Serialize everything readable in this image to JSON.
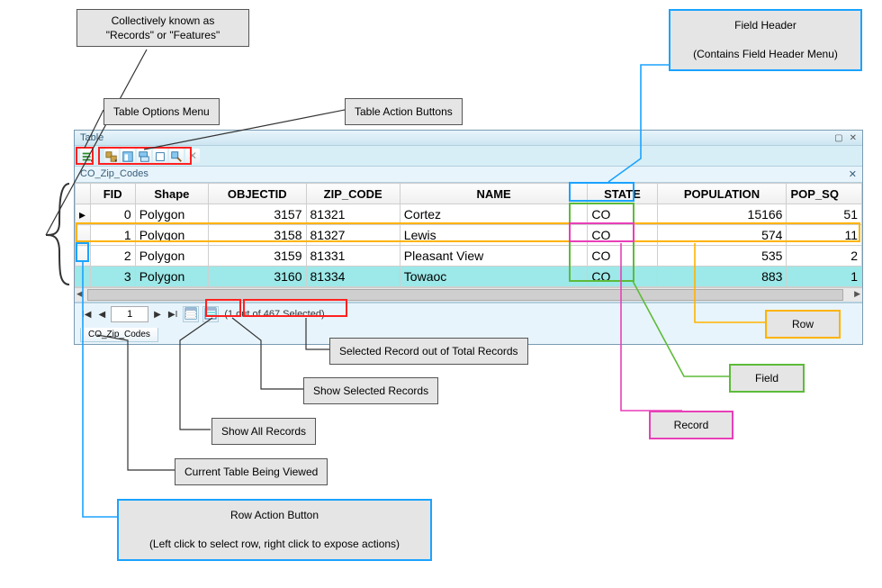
{
  "callouts": {
    "records_features": {
      "line1": "Collectively known as",
      "line2": "\"Records\" or \"Features\""
    },
    "table_options_menu": "Table Options Menu",
    "table_action_buttons": "Table Action Buttons",
    "field_header": {
      "line1": "Field Header",
      "line2": "(Contains Field Header Menu)"
    },
    "row_action_button": {
      "line1": "Row Action Button",
      "line2": "(Left click to select row, right click to expose actions)"
    },
    "current_table": "Current Table Being Viewed",
    "show_all_records": "Show All Records",
    "show_selected_records": "Show Selected Records",
    "selected_out_of_total": "Selected Record out of Total Records",
    "row": "Row",
    "field": "Field",
    "record": "Record"
  },
  "window": {
    "title": "Table",
    "sub": "CO_Zip_Codes",
    "tab": "CO_Zip_Codes"
  },
  "nav": {
    "page": "1",
    "status": "(1 out of 467 Selected)"
  },
  "columns": [
    "FID",
    "Shape",
    "OBJECTID",
    "ZIP_CODE",
    "NAME",
    "STATE",
    "POPULATION",
    "POP_SQ"
  ],
  "column_types": [
    "num",
    "text",
    "num",
    "text",
    "text",
    "text",
    "num",
    "num"
  ],
  "rows": [
    {
      "selected": false,
      "marker": "▸",
      "cells": [
        "0",
        "Polygon",
        "3157",
        "81321",
        "Cortez",
        "CO",
        "15166",
        "51"
      ]
    },
    {
      "selected": false,
      "marker": "",
      "cells": [
        "1",
        "Polygon",
        "3158",
        "81327",
        "Lewis",
        "CO",
        "574",
        "11"
      ]
    },
    {
      "selected": false,
      "marker": "",
      "cells": [
        "2",
        "Polygon",
        "3159",
        "81331",
        "Pleasant View",
        "CO",
        "535",
        "2"
      ]
    },
    {
      "selected": true,
      "marker": "",
      "cells": [
        "3",
        "Polygon",
        "3160",
        "81334",
        "Towaoc",
        "CO",
        "883",
        "1"
      ]
    }
  ],
  "colors": {
    "blue": "#1aa3ff",
    "green": "#5dbb39",
    "orange": "#ffb300",
    "magenta": "#e83fb8",
    "red": "#ff2020"
  }
}
